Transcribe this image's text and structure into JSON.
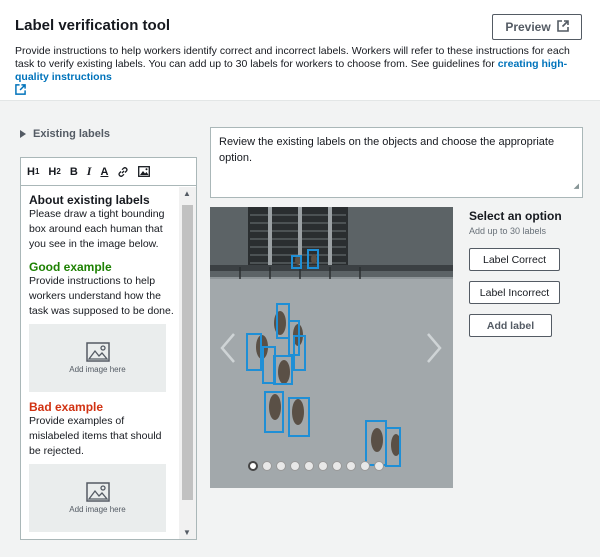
{
  "header": {
    "title": "Label verification tool",
    "preview_label": "Preview",
    "description": "Provide instructions to help workers identify correct and incorrect labels. Workers will refer to these instructions for each task to verify existing labels. You can add up to 30 labels for workers to choose from. See guidelines for ",
    "guidelines_link": "creating high-quality instructions"
  },
  "sidebar": {
    "existing_labels": "Existing labels",
    "toolbar": [
      "H1",
      "H2",
      "B",
      "I",
      "A"
    ],
    "about_heading": "About existing labels",
    "about_text": "Please draw a tight bounding box around each human that you see in the image below.",
    "good_heading": "Good example",
    "good_text": "Provide instructions to help workers understand how the task was supposed to be done.",
    "image_placeholder": "Add image here",
    "bad_heading": "Bad example",
    "bad_text": "Provide examples of mislabeled items that should be rejected.",
    "image_placeholder_2": "Add image here"
  },
  "task": {
    "instructions": "Review the existing labels on the objects and choose the appropriate option.",
    "image_count": 10,
    "active_image_index": 0
  },
  "options": {
    "title": "Select an option",
    "subtitle": "Add up to 30 labels",
    "labels": [
      "Label Correct",
      "Label Incorrect"
    ],
    "add_label": "Add label"
  },
  "colors": {
    "link": "#0073bb",
    "good": "#1d8102",
    "bad": "#d13212",
    "bbox": "#1f8fd6"
  }
}
